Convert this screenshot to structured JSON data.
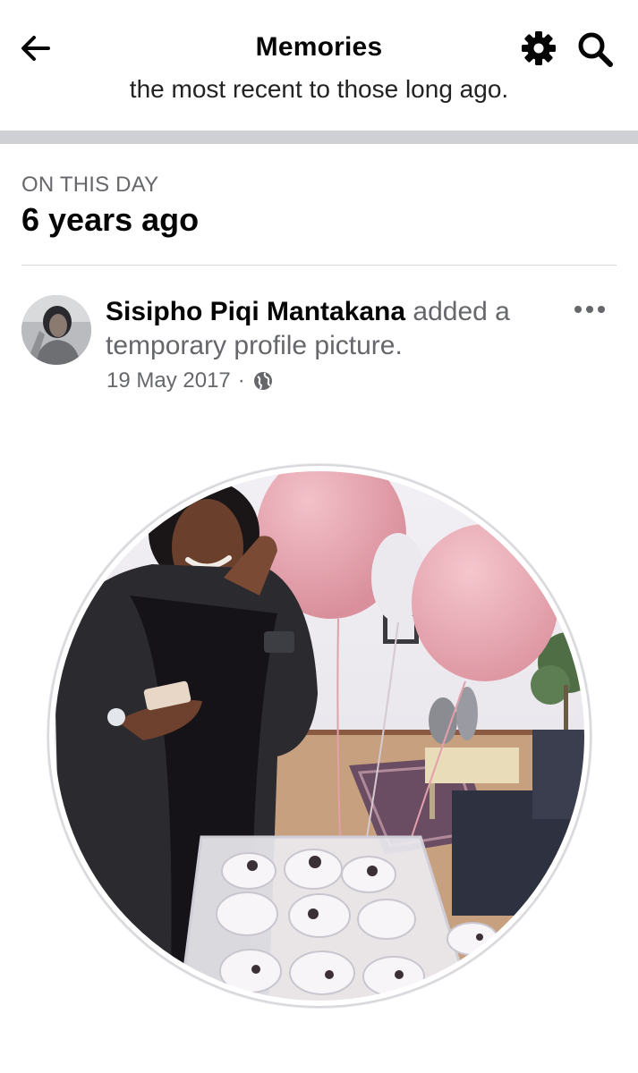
{
  "header": {
    "title": "Memories",
    "back_icon": "back-arrow-icon",
    "settings_icon": "gear-icon",
    "search_icon": "search-icon",
    "cut_off_text": "the most recent to those long ago."
  },
  "section": {
    "label": "ON THIS DAY",
    "heading": "6 years ago"
  },
  "post": {
    "author": "Sisipho Piqi Mantakana",
    "action": "added a temporary profile picture.",
    "date": "19 May 2017",
    "separator": "·",
    "privacy_icon": "globe-icon",
    "more_icon": "more-horizontal-icon"
  },
  "colors": {
    "background": "#ffffff",
    "text_primary": "#050505",
    "text_secondary": "#65676b",
    "separator": "#ced0d4",
    "balloon_pink": "#e9a7b1"
  }
}
